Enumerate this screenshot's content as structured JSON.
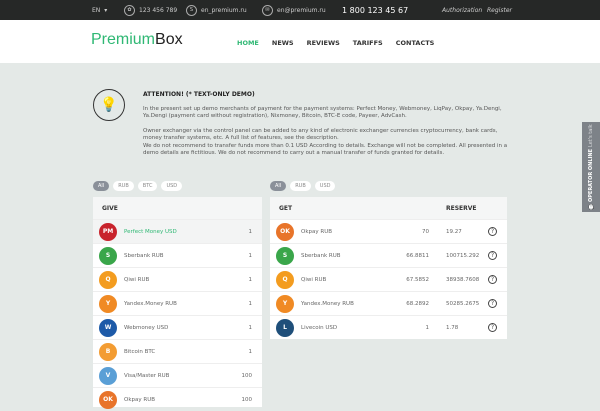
{
  "topbar": {
    "lang": "EN",
    "icq": "123 456 789",
    "skype": "en_premium.ru",
    "email": "en@premium.ru",
    "phone": "1 800 123 45 67",
    "auth": "Authorization",
    "register": "Register"
  },
  "header": {
    "logo_a": "Premium",
    "logo_b": "Box",
    "nav": [
      "HOME",
      "NEWS",
      "REVIEWS",
      "TARIFFS",
      "CONTACTS"
    ]
  },
  "notice": {
    "title": "ATTENTION! (* TEXT-ONLY DEMO)",
    "p1": "In the present set up demo merchants of payment for the payment systems: Perfect Money, Webmoney, LiqPay, Okpay, Ya.Dengi, Ya.Dengi (payment card without registration), Nixmoney, Bitcoin, BTC-E code, Payeer, AdvCash.",
    "p2": "Owner exchanger via the control panel can be added to any kind of electronic exchanger currencies cryptocurrency, bank cards, money transfer systems, etc. A full list of features, see the description.",
    "p3": "We do not recommend to transfer funds more than 0.1 USD According to details. Exchange will not be completed. All presented in a demo details are fictitious. We do not recommend to carry out a manual transfer of funds granted for details."
  },
  "give": {
    "filters": [
      "All",
      "RUB",
      "BTC",
      "USD"
    ],
    "header": "GIVE",
    "rows": [
      {
        "name": "Perfect Money USD",
        "value": "1",
        "icon": "PM",
        "color": "#c8232c"
      },
      {
        "name": "Sberbank RUB",
        "value": "1",
        "icon": "S",
        "color": "#3aa64a"
      },
      {
        "name": "Qiwi RUB",
        "value": "1",
        "icon": "Q",
        "color": "#f39c1f"
      },
      {
        "name": "Yandex.Money RUB",
        "value": "1",
        "icon": "Y",
        "color": "#f08a24"
      },
      {
        "name": "Webmoney USD",
        "value": "1",
        "icon": "W",
        "color": "#1d5aa8"
      },
      {
        "name": "Bitcoin BTC",
        "value": "1",
        "icon": "B",
        "color": "#f39c32"
      },
      {
        "name": "Visa/Master RUB",
        "value": "100",
        "icon": "V",
        "color": "#5a9fd6"
      },
      {
        "name": "Okpay RUB",
        "value": "100",
        "icon": "OK",
        "color": "#e8742a"
      }
    ]
  },
  "get": {
    "filters": [
      "All",
      "RUB",
      "USD"
    ],
    "header": "GET",
    "reserve_header": "RESERVE",
    "rows": [
      {
        "name": "Okpay RUB",
        "rate": "70",
        "reserve": "19.27",
        "icon": "OK",
        "color": "#e8742a"
      },
      {
        "name": "Sberbank RUB",
        "rate": "66.8811",
        "reserve": "100715.292",
        "icon": "S",
        "color": "#3aa64a"
      },
      {
        "name": "Qiwi RUB",
        "rate": "67.5852",
        "reserve": "38938.7608",
        "icon": "Q",
        "color": "#f39c1f"
      },
      {
        "name": "Yandex.Money RUB",
        "rate": "68.2892",
        "reserve": "50285.2675",
        "icon": "Y",
        "color": "#f08a24"
      },
      {
        "name": "Livecoin USD",
        "rate": "1",
        "reserve": "1.78",
        "icon": "L",
        "color": "#1f4f7a"
      }
    ]
  },
  "side": {
    "title": "OPERATOR ONLINE",
    "sub": "Let's talk"
  }
}
